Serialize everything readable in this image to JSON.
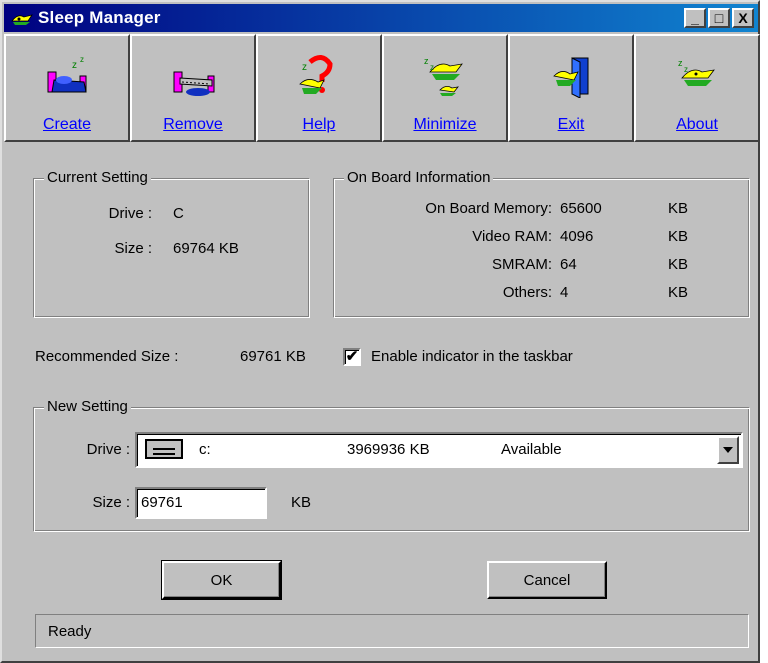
{
  "window": {
    "title": "Sleep Manager",
    "controls": {
      "minimize": "_",
      "maximize": "□",
      "close": "X"
    }
  },
  "toolbar": [
    {
      "label": "Create",
      "icon": "create-bed-icon"
    },
    {
      "label": "Remove",
      "icon": "remove-bed-icon"
    },
    {
      "label": "Help",
      "icon": "help-icon"
    },
    {
      "label": "Minimize",
      "icon": "minimize-icon"
    },
    {
      "label": "Exit",
      "icon": "exit-door-icon"
    },
    {
      "label": "About",
      "icon": "about-icon"
    }
  ],
  "current_setting": {
    "legend": "Current Setting",
    "drive_label": "Drive :",
    "drive_value": "C",
    "size_label": "Size :",
    "size_value": "69764 KB"
  },
  "on_board": {
    "legend": "On Board Information",
    "rows": [
      {
        "label": "On Board Memory:",
        "value": "65600",
        "unit": "KB"
      },
      {
        "label": "Video RAM:",
        "value": "4096",
        "unit": "KB"
      },
      {
        "label": "SMRAM:",
        "value": "64",
        "unit": "KB"
      },
      {
        "label": "Others:",
        "value": "4",
        "unit": "KB"
      }
    ]
  },
  "recommended": {
    "label": "Recommended Size :",
    "value": "69761 KB"
  },
  "indicator": {
    "checked": true,
    "mark": "✔",
    "label": "Enable indicator in the taskbar"
  },
  "new_setting": {
    "legend": "New Setting",
    "drive_label": "Drive :",
    "drive_letter": "c:",
    "drive_size": "3969936 KB",
    "drive_status": "Available",
    "size_label": "Size :",
    "size_value": "69761",
    "size_unit": "KB"
  },
  "buttons": {
    "ok": "OK",
    "cancel": "Cancel"
  },
  "status": "Ready",
  "colors": {
    "face": "#c0c0c0",
    "title_start": "#000080",
    "title_end": "#1084d0",
    "link": "#0000ff"
  }
}
